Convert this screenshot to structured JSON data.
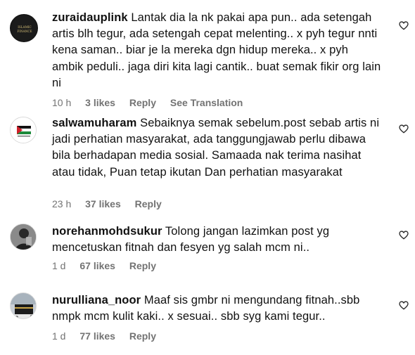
{
  "comments": [
    {
      "username": "zuraidauplink",
      "text": "Lantak dia la nk pakai apa pun.. ada setengah artis blh tegur, ada setengah cepat melenting.. x pyh tegur nnti kena saman.. biar je la mereka dgn hidup mereka.. x pyh ambik peduli.. jaga diri kita lagi cantik.. buat semak fikir org lain ni",
      "time": "10 h",
      "likes": "3 likes",
      "reply": "Reply",
      "translation": "See Translation",
      "avatar_text": [
        "ISLAMIC",
        "FINANCE"
      ]
    },
    {
      "username": "salwamuharam",
      "text": "Sebaiknya semak sebelum.post sebab artis ni jadi perhatian masyarakat, ada tanggungjawab perlu dibawa bila berhadapan media sosial. Samaada nak terima nasihat atau tidak, Puan tetap ikutan Dan perhatian masyarakat",
      "time": "23 h",
      "likes": "37 likes",
      "reply": "Reply"
    },
    {
      "username": "norehanmohdsukur",
      "text": "Tolong jangan lazimkan post yg mencetuskan fitnah dan fesyen yg salah mcm ni..",
      "time": "1 d",
      "likes": "67 likes",
      "reply": "Reply"
    },
    {
      "username": "nurulliana_noor",
      "text": "Maaf sis gmbr ni mengundang fitnah..sbb nmpk mcm kulit kaki.. x sesuai.. sbb syg kami tegur..",
      "time": "1 d",
      "likes": "77 likes",
      "reply": "Reply"
    }
  ],
  "icons": {
    "like": "heart-outline-icon"
  },
  "colors": {
    "meta": "#737373",
    "text": "#111111"
  }
}
